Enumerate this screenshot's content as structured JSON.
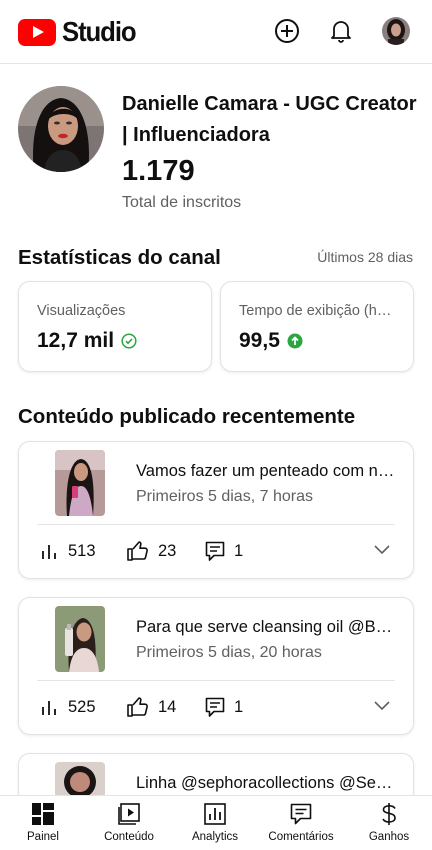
{
  "app": {
    "brand": "Studio"
  },
  "header": {
    "icons": [
      "create-icon",
      "notifications-icon",
      "account-avatar"
    ]
  },
  "channel": {
    "name": "Danielle Camara - UGC Creator | Influenciadora",
    "subscriber_count": "1.179",
    "subscriber_label": "Total de inscritos"
  },
  "stats": {
    "title": "Estatísticas do canal",
    "period": "Últimos 28 dias",
    "cards": [
      {
        "label": "Visualizações",
        "value": "12,7 mil",
        "indicator": "check-circle-icon",
        "indicator_color": "#2ba640"
      },
      {
        "label": "Tempo de exibição (horas)",
        "value": "99,5",
        "indicator": "arrow-up-circle-icon",
        "indicator_color": "#2ba640"
      }
    ]
  },
  "recent": {
    "title": "Conteúdo publicado recentemente",
    "videos": [
      {
        "title": "Vamos fazer um penteado com nós?",
        "subtitle": "Primeiros 5 dias, 7 horas",
        "views": "513",
        "likes": "23",
        "comments": "1"
      },
      {
        "title": "Para que serve cleansing oil @Boticário",
        "subtitle": "Primeiros 5 dias, 20 horas",
        "views": "525",
        "likes": "14",
        "comments": "1"
      },
      {
        "title": "Linha @sephoracollections @Sephora",
        "subtitle": "",
        "views": "",
        "likes": "",
        "comments": ""
      }
    ]
  },
  "nav": {
    "items": [
      {
        "label": "Painel",
        "icon": "dashboard-icon",
        "active": true
      },
      {
        "label": "Conteúdo",
        "icon": "content-icon",
        "active": false
      },
      {
        "label": "Analytics",
        "icon": "analytics-icon",
        "active": false
      },
      {
        "label": "Comentários",
        "icon": "comments-icon",
        "active": false
      },
      {
        "label": "Ganhos",
        "icon": "earn-icon",
        "active": false
      }
    ]
  },
  "colors": {
    "brand_red": "#ff0000",
    "positive_green": "#2ba640",
    "secondary_text": "#606060"
  }
}
